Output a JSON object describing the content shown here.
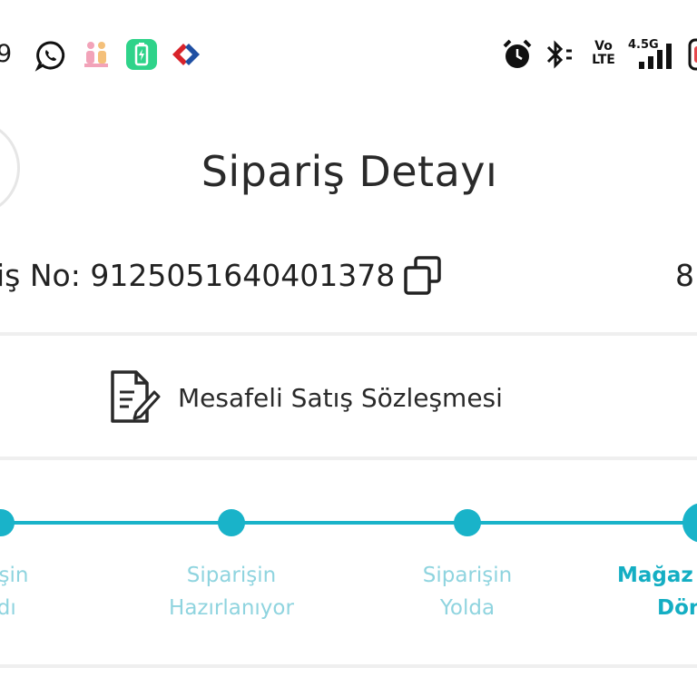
{
  "status_bar": {
    "time": "9",
    "icons": [
      "whatsapp-icon",
      "family-app-icon",
      "battery-saver-icon",
      "carrefour-icon",
      "alarm-icon",
      "bluetooth-icon",
      "volte-icon",
      "signal-4-5g-icon",
      "screen-record-icon"
    ],
    "volte_top": "Vo",
    "volte_bottom": "LTE",
    "network": "4.5G"
  },
  "header": {
    "title": "Sipariş Detayı"
  },
  "order": {
    "label": "iş No: 9125051640401378",
    "right_value": "8"
  },
  "contract": {
    "label": "Mesafeli Satış Sözleşmesi"
  },
  "tracker": {
    "accent": "#19b3c9",
    "inactive_text": "#8fd4df",
    "steps": [
      {
        "line1": "arişin",
        "line2": "ndı"
      },
      {
        "line1": "Siparişin",
        "line2": "Hazırlanıyor"
      },
      {
        "line1": "Siparişin",
        "line2": "Yolda"
      },
      {
        "line1": "Mağaz",
        "line2": "Dön"
      }
    ]
  }
}
